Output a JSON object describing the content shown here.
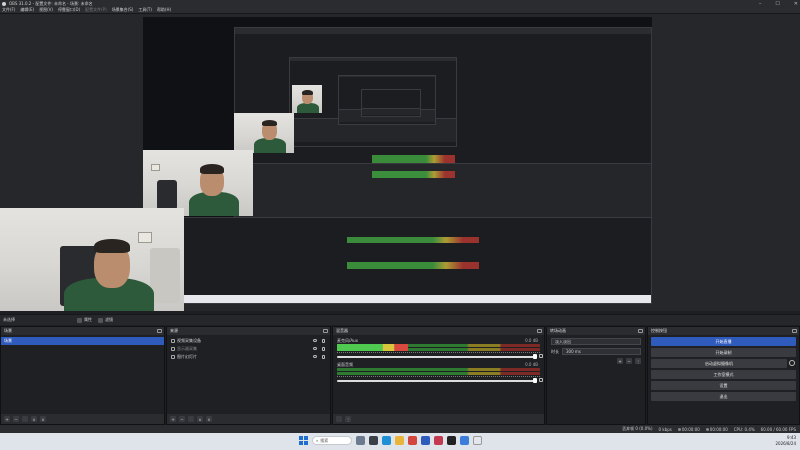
{
  "window": {
    "title": "OBS 31.0.2 - 配置文件: 未命名 - 场景: 未命名"
  },
  "window_controls": [
    "–",
    "☐",
    "✕"
  ],
  "menu": [
    "文件(F)",
    "编辑(E)",
    "视图(V)",
    "停靠窗口(D)",
    "配置文件(P)",
    "场景集合(S)",
    "工具(T)",
    "帮助(H)"
  ],
  "scene_tabs": {
    "scene_label": "未选择",
    "properties": "属性",
    "filters": "滤镜"
  },
  "docks": {
    "scenes": {
      "title": "场景",
      "items": [
        "场景"
      ]
    },
    "sources": {
      "title": "来源",
      "items": [
        {
          "label": "视频采集设备",
          "dim": false
        },
        {
          "label": "显示器采集",
          "dim": true
        },
        {
          "label": "图片幻灯片",
          "dim": false
        }
      ]
    },
    "mixer": {
      "title": "混音器",
      "channels": [
        {
          "name": "麦克风/Aux",
          "value": "0.0 dB"
        },
        {
          "name": "桌面音频",
          "value": "0.0 dB"
        }
      ]
    },
    "transitions": {
      "title": "转场动画",
      "selected": "淡入淡出",
      "duration_label": "时长",
      "duration_value": "300 ms"
    },
    "controls": {
      "title": "控制按钮",
      "buttons": [
        "开始直播",
        "开始录制",
        "启动虚拟摄像机",
        "工作室模式",
        "设置",
        "退出"
      ]
    }
  },
  "status": {
    "recording": "00:00:00",
    "streaming": "00:00:00",
    "dropped": "丢弃帧 0 (0.0%)",
    "kbps": "0 kbps",
    "cpu": "CPU: 0.4%",
    "fps": "60.00 / 60.00 FPS"
  },
  "taskbar": {
    "search": "搜索",
    "time": "9:43",
    "date": "2026/8/24"
  },
  "colors": {
    "accent": "#2f5bbd",
    "meter_green": "#4fc94f",
    "meter_yellow": "#d9c63a",
    "meter_red": "#d84a40"
  },
  "icons": {
    "plus": "+",
    "minus": "−",
    "up": "∧",
    "down": "∨",
    "dots": "⋮"
  }
}
